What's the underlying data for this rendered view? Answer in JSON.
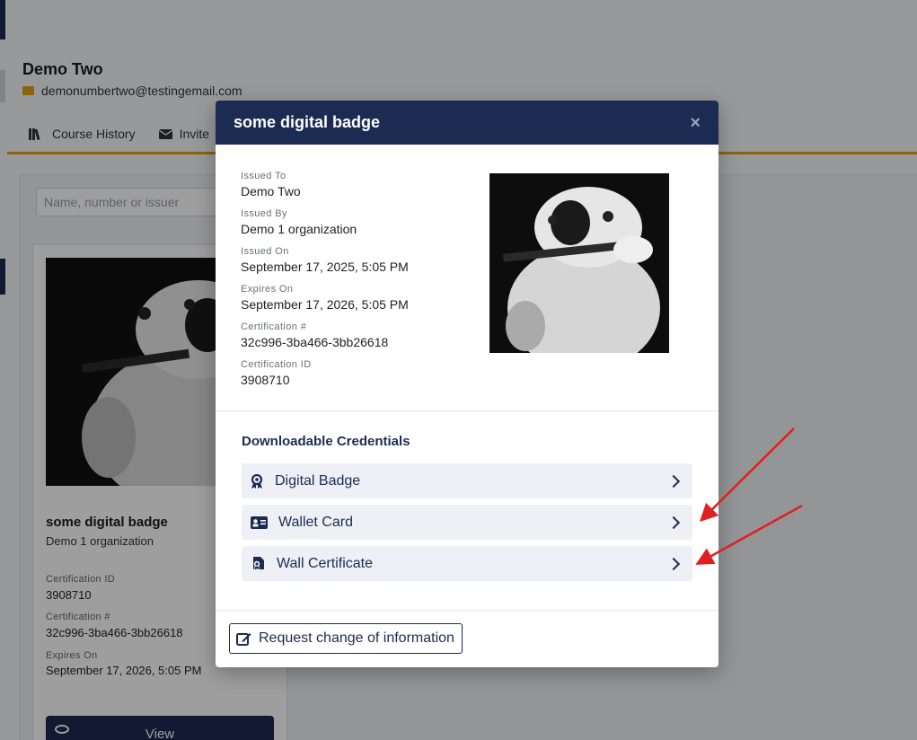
{
  "background": {
    "profile_name": "Demo Two",
    "profile_email": "demonumbertwo@testingemail.com",
    "tabs": [
      {
        "label": "Course History",
        "icon": "books-icon"
      },
      {
        "label": "Invite",
        "icon": "envelope-icon"
      }
    ],
    "search_placeholder": "Name, number or issuer",
    "card": {
      "title": "some digital badge",
      "org": "Demo 1 organization",
      "cert_id_label": "Certification ID",
      "cert_id": "3908710",
      "cert_num_label": "Certification #",
      "cert_num": "32c996-3ba466-3bb26618",
      "expires_label": "Expires On",
      "expires": "September 17, 2026, 5:05 PM",
      "view_label": "View"
    }
  },
  "modal": {
    "title": "some digital badge",
    "close": "×",
    "details": [
      {
        "label": "Issued To",
        "value": "Demo Two"
      },
      {
        "label": "Issued By",
        "value": "Demo 1 organization"
      },
      {
        "label": "Issued On",
        "value": "September 17, 2025, 5:05 PM"
      },
      {
        "label": "Expires On",
        "value": "September 17, 2026, 5:05 PM"
      },
      {
        "label": "Certification #",
        "value": "32c996-3ba466-3bb26618"
      },
      {
        "label": "Certification ID",
        "value": "3908710"
      }
    ],
    "downloadable_title": "Downloadable Credentials",
    "credentials": [
      {
        "label": "Digital Badge",
        "icon": "award-ribbon-icon"
      },
      {
        "label": "Wallet Card",
        "icon": "id-card-icon"
      },
      {
        "label": "Wall Certificate",
        "icon": "certificate-icon"
      }
    ],
    "request_label": "Request change of information"
  },
  "colors": {
    "navy": "#1c2b52",
    "gold": "#e0a11b",
    "annotation_arrow": "#e02020"
  }
}
